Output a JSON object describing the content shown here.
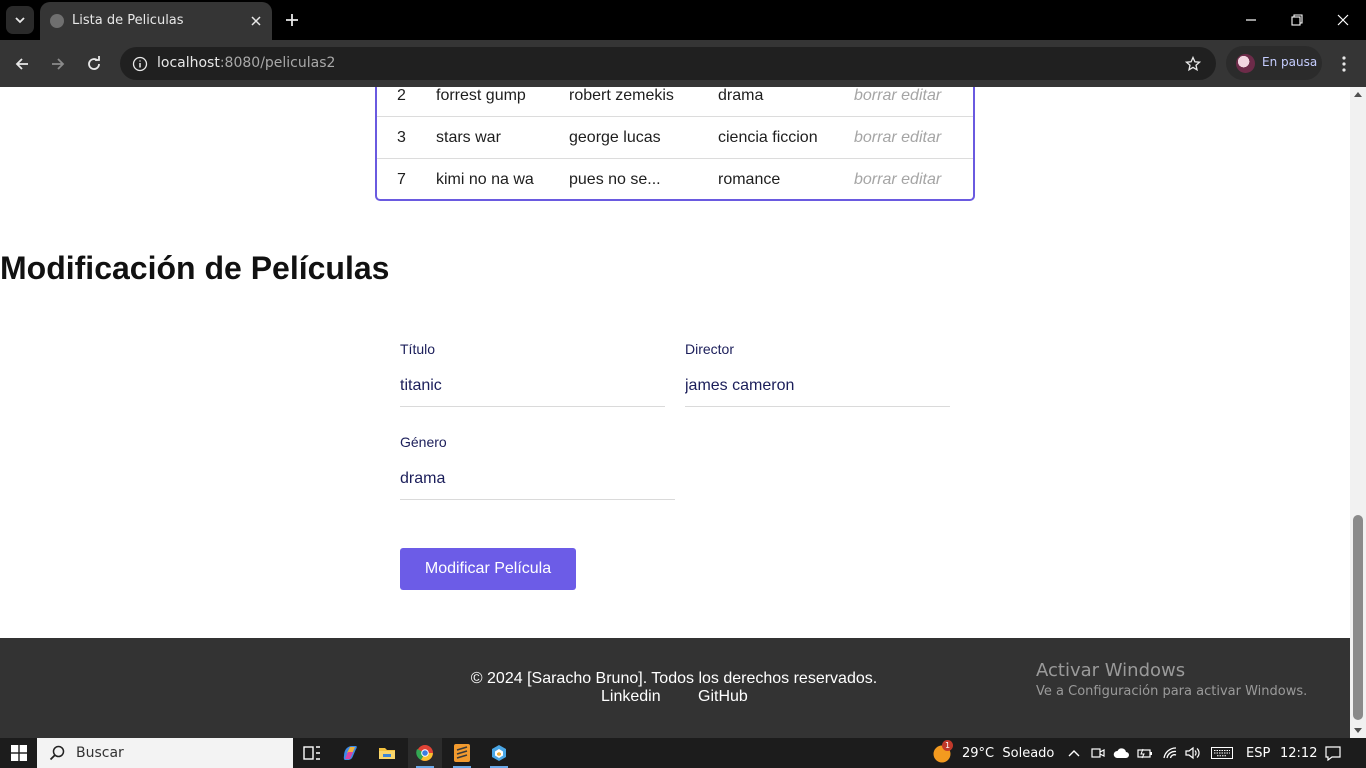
{
  "browser": {
    "tab_title": "Lista de Peliculas",
    "url_host": "localhost",
    "url_path": ":8080/peliculas2",
    "profile_label": "En pausa"
  },
  "table": {
    "rows": [
      {
        "id": "2",
        "title": "forrest gump",
        "director": "robert zemekis",
        "genre": "drama",
        "delete_label": "borrar",
        "edit_label": "editar"
      },
      {
        "id": "3",
        "title": "stars war",
        "director": "george lucas",
        "genre": "ciencia ficcion",
        "delete_label": "borrar",
        "edit_label": "editar"
      },
      {
        "id": "7",
        "title": "kimi no na wa",
        "director": "pues no se...",
        "genre": "romance",
        "delete_label": "borrar",
        "edit_label": "editar"
      }
    ]
  },
  "form": {
    "heading": "Modificación de Películas",
    "title_label": "Título",
    "title_value": "titanic",
    "director_label": "Director",
    "director_value": "james cameron",
    "genre_label": "Género",
    "genre_value": "drama",
    "submit_label": "Modificar Película"
  },
  "footer": {
    "copyright": "© 2024 [Saracho Bruno]. Todos los derechos reservados.",
    "linkedin": "Linkedin",
    "github": "GitHub"
  },
  "watermark": {
    "title": "Activar Windows",
    "subtitle": "Ve a Configuración para activar Windows."
  },
  "taskbar": {
    "search_placeholder": "Buscar",
    "weather_badge": "1",
    "weather": "29°C  Soleado",
    "language": "ESP",
    "time": "12:12"
  },
  "colors": {
    "accent": "#6c5ce7",
    "table_border": "#6a5ae0",
    "footer_bg": "#333333"
  }
}
